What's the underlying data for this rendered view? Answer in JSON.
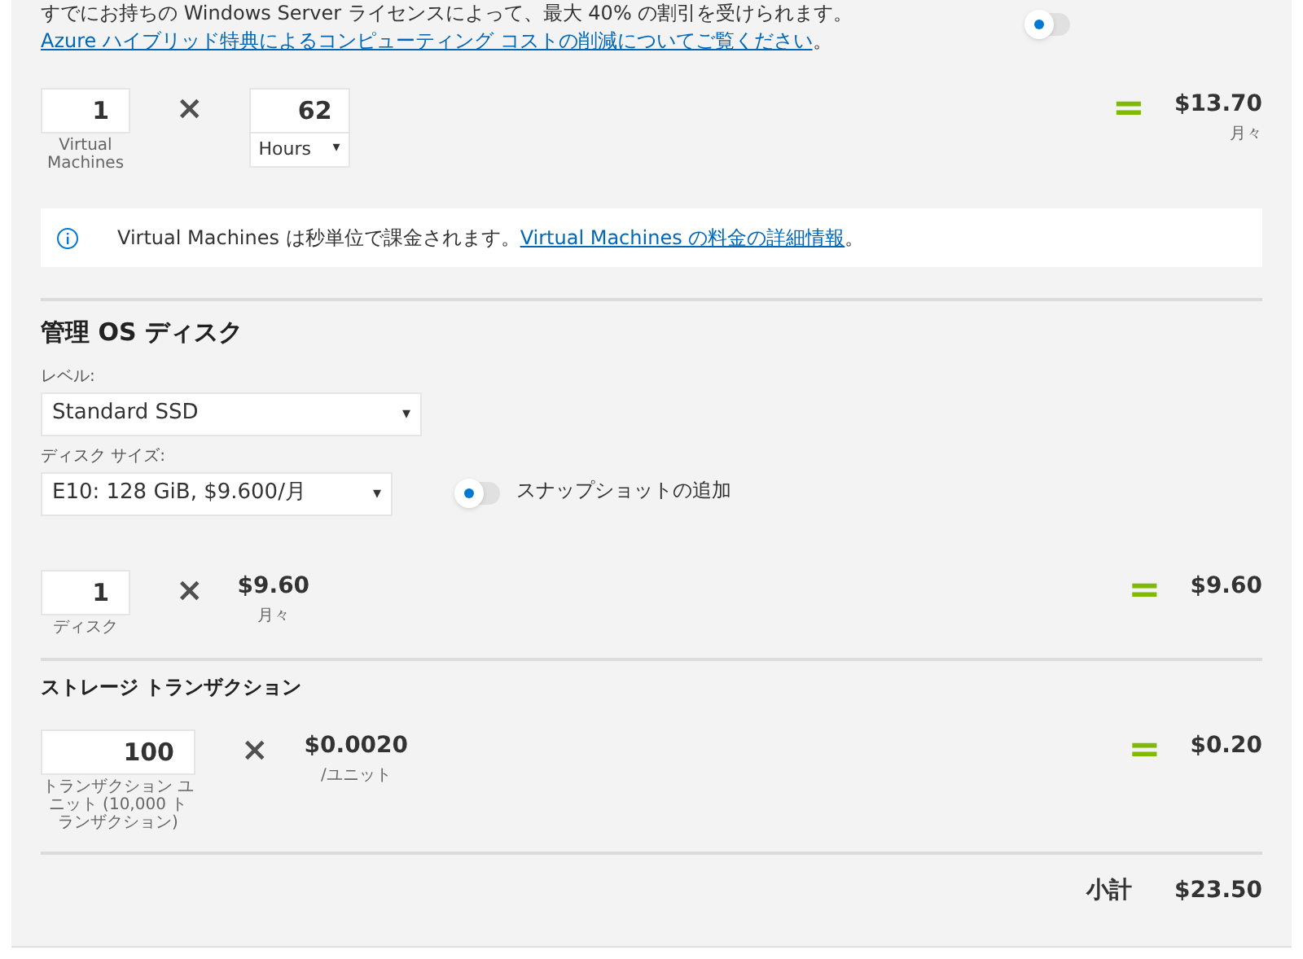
{
  "hybrid_benefit": {
    "text": "すでにお持ちの Windows Server ライセンスによって、最大 40% の割引を受けられます。",
    "link": "Azure ハイブリッド特典によるコンピューティング コストの削減についてご覧ください",
    "after": "。",
    "on": false
  },
  "vm": {
    "count": "1",
    "count_label": "Virtual Machines",
    "times": "×",
    "hours": "62",
    "unit": "Hours",
    "caret": "▾",
    "equals": "=",
    "total": "$13.70",
    "total_period": "月々"
  },
  "info": {
    "text": "Virtual Machines は秒単位で課金されます。",
    "link": "Virtual Machines の料金の詳細情報",
    "after": "。"
  },
  "os_disk": {
    "heading": "管理 OS ディスク",
    "tier_label": "レベル:",
    "tier": "Standard SSD",
    "size_label": "ディスク サイズ:",
    "size": "E10: 128 GiB, $9.600/月",
    "caret": "▾",
    "snapshot": {
      "label": "スナップショットの追加",
      "on": false
    },
    "count": "1",
    "count_label": "ディスク",
    "times": "×",
    "price": "$9.60",
    "price_period": "月々",
    "equals": "=",
    "total": "$9.60"
  },
  "transactions": {
    "heading": "ストレージ トランザクション",
    "count": "100",
    "count_label": "トランザクション ユニット (10,000 トランザクション)",
    "times": "×",
    "price": "$0.0020",
    "price_period": "/ユニット",
    "equals": "=",
    "total": "$0.20"
  },
  "subtotal": {
    "label": "小計",
    "value": "$23.50"
  }
}
